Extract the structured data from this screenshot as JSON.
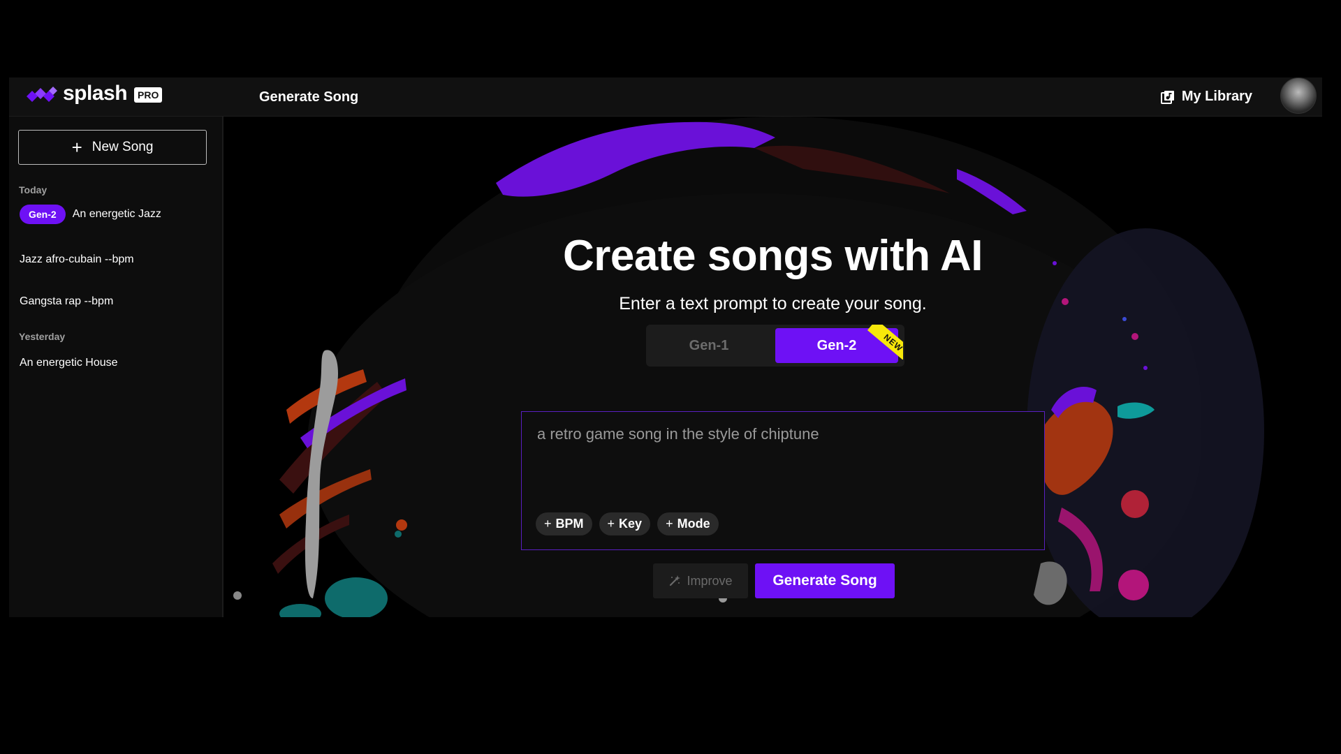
{
  "header": {
    "logo_text": "splash",
    "logo_badge": "PRO",
    "nav_title": "Generate Song",
    "library_label": "My Library",
    "library_icon": "library-music-icon",
    "avatar_icon": "user-avatar"
  },
  "sidebar": {
    "new_song_label": "New Song",
    "groups": [
      {
        "label": "Today",
        "items": [
          {
            "badge": "Gen-2",
            "label": "An energetic Jazz"
          },
          {
            "badge": "",
            "label": "Jazz afro-cubain --bpm"
          },
          {
            "badge": "",
            "label": "Gangsta rap --bpm"
          }
        ]
      },
      {
        "label": "Yesterday",
        "items": [
          {
            "badge": "",
            "label": "An energetic House"
          }
        ]
      }
    ]
  },
  "main": {
    "title": "Create songs with AI",
    "subtitle": "Enter a text prompt to create your song.",
    "generations": [
      {
        "label": "Gen-1",
        "selected": false
      },
      {
        "label": "Gen-2",
        "selected": true,
        "ribbon": "NEW"
      }
    ],
    "prompt_value": "a retro game song in the style of chiptune",
    "chips": [
      "BPM",
      "Key",
      "Mode"
    ],
    "improve_label": "Improve",
    "improve_icon": "magic-wand-icon",
    "generate_label": "Generate Song"
  },
  "colors": {
    "accent": "#6e11f5",
    "ribbon": "#f7e80a",
    "background": "#000000"
  }
}
